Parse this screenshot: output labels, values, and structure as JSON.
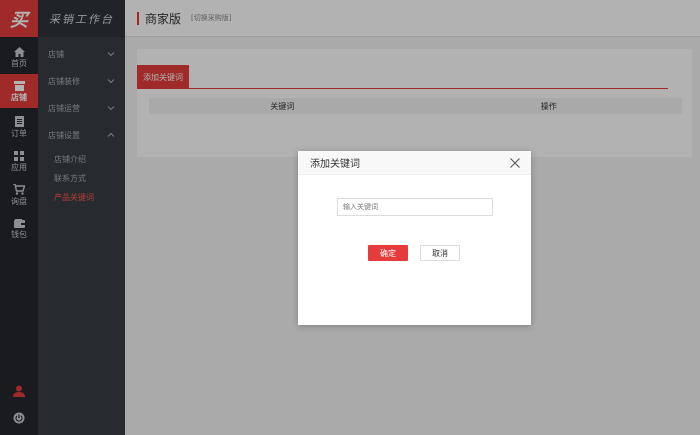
{
  "brand": {
    "logo_text": "买",
    "name": "采销工作台"
  },
  "rail": {
    "items": [
      {
        "label": "首页",
        "icon": "home-icon"
      },
      {
        "label": "店铺",
        "icon": "store-icon",
        "active": true
      },
      {
        "label": "订单",
        "icon": "order-icon"
      },
      {
        "label": "应用",
        "icon": "apps-icon"
      },
      {
        "label": "询盘",
        "icon": "cart-icon"
      },
      {
        "label": "钱包",
        "icon": "wallet-icon"
      }
    ],
    "bottom": [
      {
        "icon": "user-icon"
      },
      {
        "icon": "power-icon"
      }
    ]
  },
  "sidebar": {
    "groups": [
      {
        "label": "店铺"
      },
      {
        "label": "店铺装修"
      },
      {
        "label": "店铺运营"
      },
      {
        "label": "店铺设置"
      }
    ],
    "subitems": [
      {
        "label": "店铺介绍"
      },
      {
        "label": "联系方式"
      },
      {
        "label": "产品关键词",
        "active": true
      }
    ]
  },
  "header": {
    "title": "商家版",
    "switch_link": "[切换采购版]"
  },
  "main": {
    "tab_label": "添加关键词",
    "table_headers": [
      "关键词",
      "操作"
    ]
  },
  "modal": {
    "title": "添加关键词",
    "input_placeholder": "输入关键词",
    "input_value": "",
    "ok_label": "确定",
    "cancel_label": "取消"
  },
  "colors": {
    "accent": "#e63b3b",
    "rail_bg": "#24282d",
    "sidebar_bg": "#383e46"
  }
}
